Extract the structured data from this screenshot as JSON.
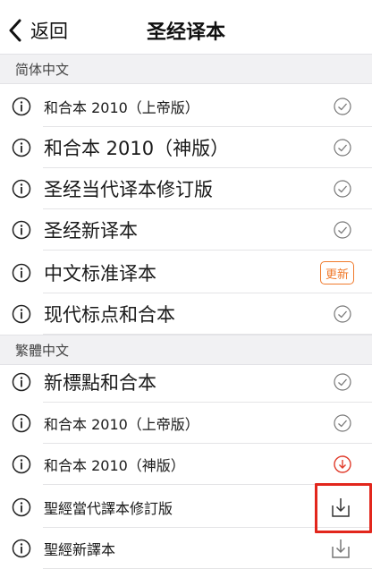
{
  "header": {
    "back_label": "返回",
    "title": "圣经译本"
  },
  "sections": [
    {
      "title": "简体中文",
      "items": [
        {
          "label": "和合本 2010（上帝版）",
          "status": "downloaded",
          "icon": "checkmark-circle-icon"
        },
        {
          "label": "和合本 2010（神版）",
          "status": "downloaded",
          "icon": "checkmark-circle-icon"
        },
        {
          "label": "圣经当代译本修订版",
          "status": "downloaded",
          "icon": "checkmark-circle-icon"
        },
        {
          "label": "圣经新译本",
          "status": "downloaded",
          "icon": "checkmark-circle-icon"
        },
        {
          "label": "中文标准译本",
          "status": "update",
          "badge": "更新"
        },
        {
          "label": "现代标点和合本",
          "status": "downloaded",
          "icon": "checkmark-circle-icon"
        }
      ]
    },
    {
      "title": "繁體中文",
      "items": [
        {
          "label": "新標點和合本",
          "status": "downloaded",
          "icon": "checkmark-circle-icon"
        },
        {
          "label": "和合本 2010（上帝版）",
          "status": "downloaded",
          "icon": "checkmark-circle-icon"
        },
        {
          "label": "和合本 2010（神版）",
          "status": "downloading",
          "icon": "download-arrow-circle-icon"
        },
        {
          "label": "聖經當代譯本修訂版",
          "status": "available",
          "icon": "download-tray-icon"
        },
        {
          "label": "聖經新譯本",
          "status": "available",
          "icon": "download-tray-icon"
        }
      ]
    }
  ],
  "colors": {
    "accent_update": "#f07a2c",
    "downloading": "#e03a2a",
    "highlight_frame": "#e2261c",
    "section_bg": "#f1f1f3"
  }
}
